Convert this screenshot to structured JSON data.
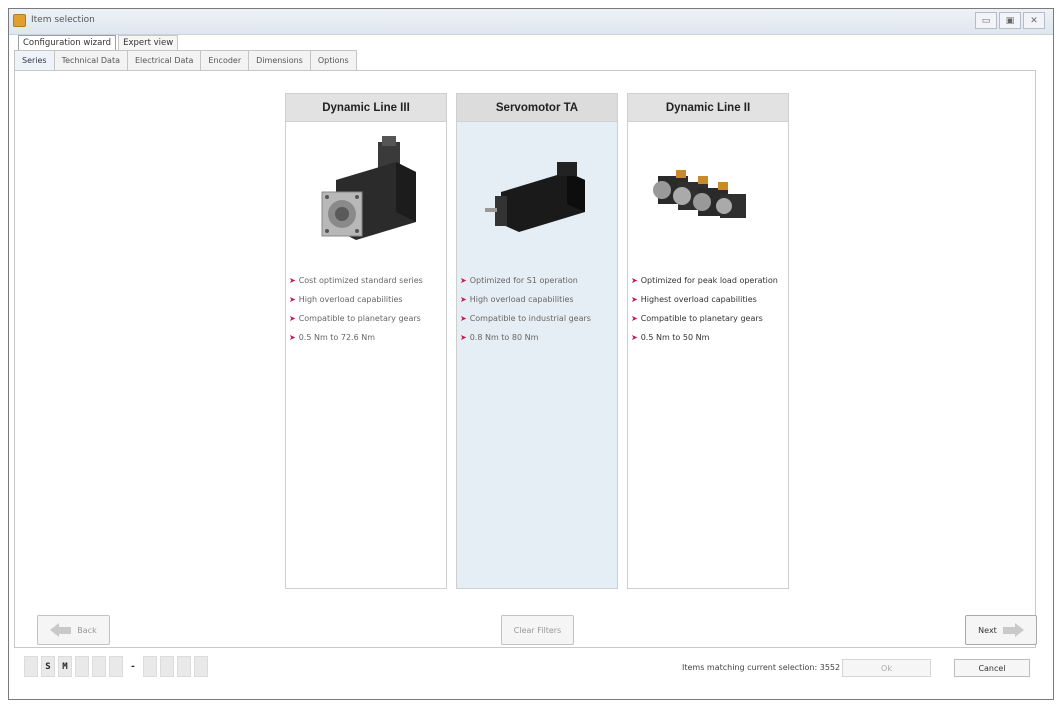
{
  "window": {
    "title": "Item selection",
    "minimize": "▭",
    "maximize": "▣",
    "close": "✕"
  },
  "modes": [
    {
      "label": "Configuration wizard"
    },
    {
      "label": "Expert view"
    }
  ],
  "tabs": [
    {
      "label": "Series"
    },
    {
      "label": "Technical Data"
    },
    {
      "label": "Electrical Data"
    },
    {
      "label": "Encoder"
    },
    {
      "label": "Dimensions"
    },
    {
      "label": "Options"
    }
  ],
  "cards": [
    {
      "title": "Dynamic Line III",
      "features": [
        "Cost optimized standard series",
        "High overload capabilities",
        "Compatible to planetary gears",
        "0.5 Nm to 72.6 Nm"
      ]
    },
    {
      "title": "Servomotor TA",
      "features": [
        "Optimized for S1 operation",
        "High overload capabilities",
        "Compatible to industrial gears",
        "0.8 Nm to 80 Nm"
      ]
    },
    {
      "title": "Dynamic Line II",
      "features": [
        "Optimized for peak load operation",
        "Highest overload capabilities",
        "Compatible to planetary gears",
        "0.5 Nm to 50 Nm"
      ]
    }
  ],
  "buttons": {
    "back": "Back",
    "clear_filters": "Clear Filters",
    "next": "Next",
    "ok": "Ok",
    "cancel": "Cancel"
  },
  "status": {
    "code_chars": [
      "",
      "S",
      "M",
      "",
      "",
      "",
      "-",
      "",
      "",
      "",
      ""
    ],
    "matching": "Items matching current selection: 3552"
  },
  "colors": {
    "accent_arrow": "#c8174a",
    "selected_card": "#e6eef5"
  }
}
